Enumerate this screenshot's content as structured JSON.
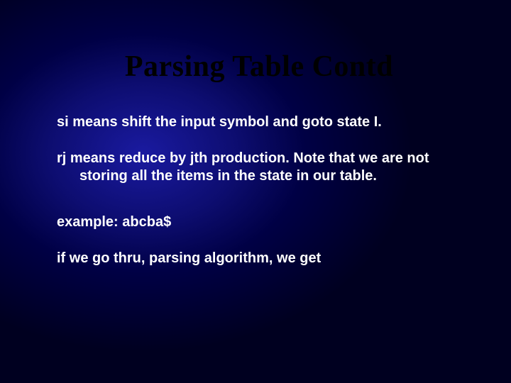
{
  "slide": {
    "title": "Parsing Table Contd",
    "paragraphs": [
      "si means shift the input symbol and goto state I.",
      "rj means reduce by jth production. Note that we are not storing all the items in the state in our table.",
      "example: abcba$",
      "if we go thru, parsing algorithm, we get"
    ]
  }
}
